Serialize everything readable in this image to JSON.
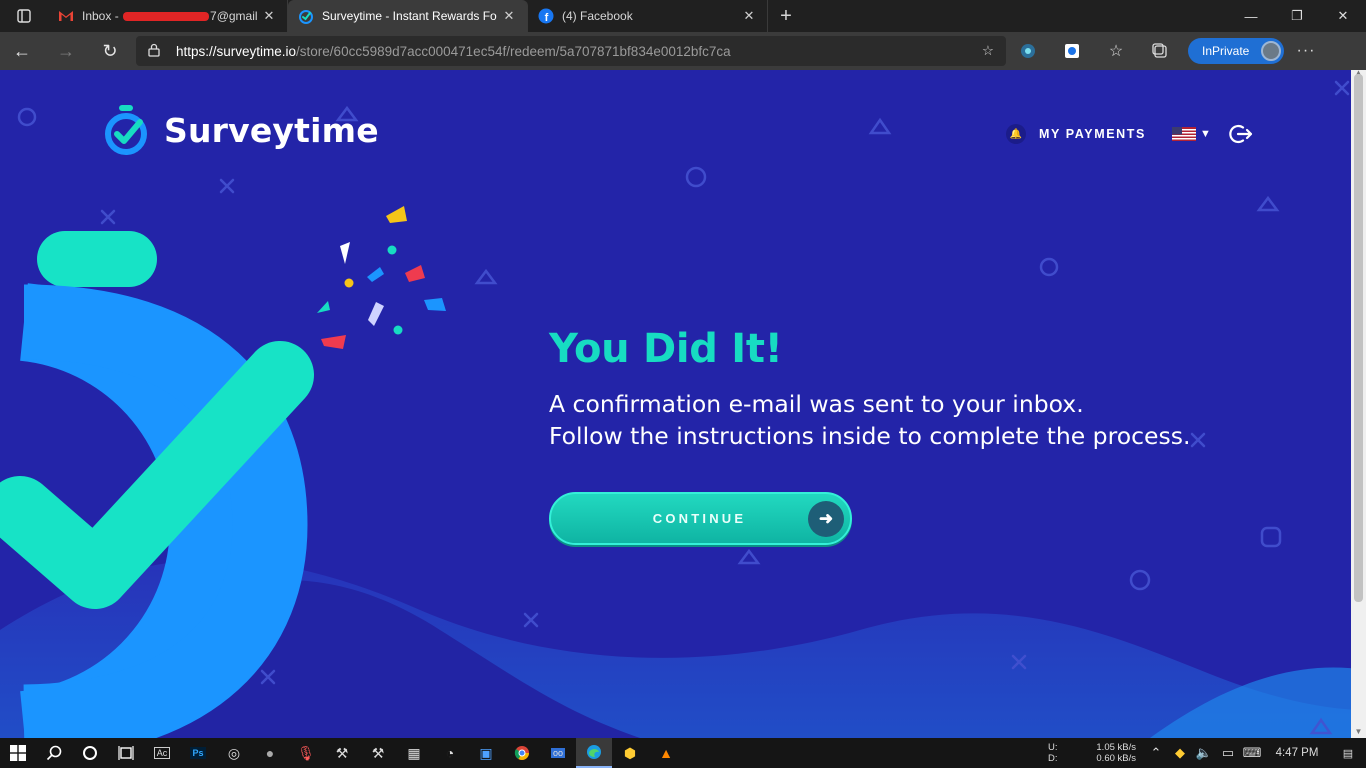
{
  "browser": {
    "tabs": [
      {
        "title_prefix": "Inbox - ",
        "title_suffix": "7@gmail",
        "active": false,
        "icon": "gmail-icon"
      },
      {
        "title": "Surveytime - Instant Rewards Fo",
        "active": true,
        "icon": "surveytime-icon"
      },
      {
        "title": "(4) Facebook",
        "active": false,
        "icon": "facebook-icon"
      }
    ],
    "url_host": "https://surveytime.io",
    "url_path": "/store/60cc5989d7acc000471ec54f/redeem/5a707871bf834e0012bfc7ca",
    "inprivate_label": "InPrivate"
  },
  "site": {
    "logo_text": "Surveytime",
    "nav": {
      "payments_label": "MY PAYMENTS",
      "language": "en-US flag"
    },
    "colors": {
      "background": "#2324a8",
      "accent": "#17dcc2",
      "blue": "#1b95ff"
    }
  },
  "main": {
    "title": "You Did It!",
    "line1": "A confirmation e-mail was sent to your inbox.",
    "line2": "Follow the instructions inside to complete the process.",
    "cta_label": "CONTINUE"
  },
  "taskbar": {
    "net_up_label": "U:",
    "net_up": "1.05 kB/s",
    "net_down_label": "D:",
    "net_down": "0.60 kB/s",
    "time": "4:47 PM"
  }
}
